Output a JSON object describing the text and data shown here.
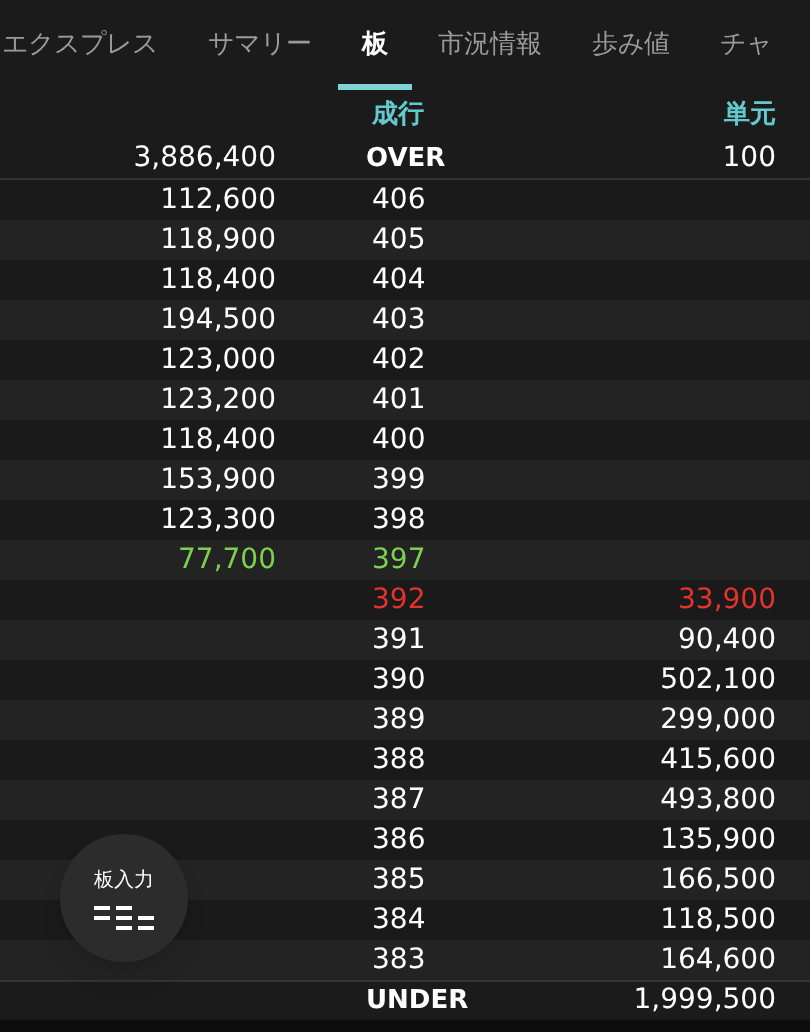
{
  "tabs": [
    {
      "label": "エクスプレス",
      "selected": false
    },
    {
      "label": "サマリー",
      "selected": false
    },
    {
      "label": "板",
      "selected": true
    },
    {
      "label": "市況情報",
      "selected": false
    },
    {
      "label": "歩み値",
      "selected": false
    },
    {
      "label": "チャ",
      "selected": false
    }
  ],
  "board": {
    "header": {
      "price": "成行",
      "buy": "単元"
    },
    "over": {
      "sell": "3,886,400",
      "price": "OVER",
      "buy": "100"
    },
    "rows": [
      {
        "kind": "ask",
        "sell": "112,600",
        "price": "406"
      },
      {
        "kind": "ask",
        "sell": "118,900",
        "price": "405"
      },
      {
        "kind": "ask",
        "sell": "118,400",
        "price": "404"
      },
      {
        "kind": "ask",
        "sell": "194,500",
        "price": "403"
      },
      {
        "kind": "ask",
        "sell": "123,000",
        "price": "402"
      },
      {
        "kind": "ask",
        "sell": "123,200",
        "price": "401"
      },
      {
        "kind": "ask",
        "sell": "118,400",
        "price": "400"
      },
      {
        "kind": "ask",
        "sell": "153,900",
        "price": "399"
      },
      {
        "kind": "ask",
        "sell": "123,300",
        "price": "398"
      },
      {
        "kind": "best_ask",
        "sell": "77,700",
        "price": "397"
      },
      {
        "kind": "best_bid",
        "price": "392",
        "buy": "33,900"
      },
      {
        "kind": "bid",
        "price": "391",
        "buy": "90,400"
      },
      {
        "kind": "bid",
        "price": "390",
        "buy": "502,100"
      },
      {
        "kind": "bid",
        "price": "389",
        "buy": "299,000"
      },
      {
        "kind": "bid",
        "price": "388",
        "buy": "415,600"
      },
      {
        "kind": "bid",
        "price": "387",
        "buy": "493,800"
      },
      {
        "kind": "bid",
        "price": "386",
        "buy": "135,900"
      },
      {
        "kind": "bid",
        "price": "385",
        "buy": "166,500"
      },
      {
        "kind": "bid",
        "price": "384",
        "buy": "118,500"
      },
      {
        "kind": "bid",
        "price": "383",
        "buy": "164,600"
      }
    ],
    "under": {
      "price": "UNDER",
      "buy": "1,999,500"
    }
  },
  "fab": {
    "label": "板入力"
  }
}
